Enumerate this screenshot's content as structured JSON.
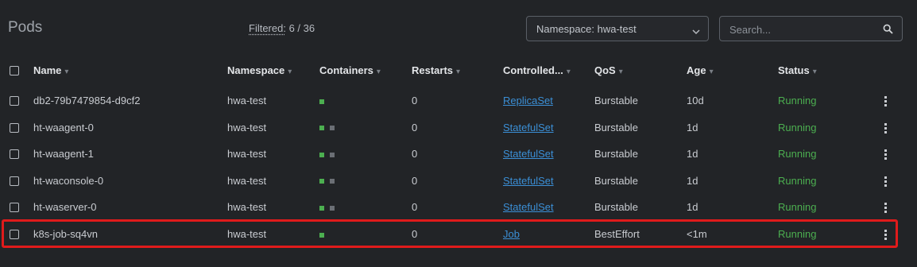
{
  "page": {
    "title": "Pods",
    "filtered_label": "Filtered:",
    "filtered_count": "6 / 36"
  },
  "namespace_select": {
    "label": "Namespace: hwa-test",
    "icon": "chevron-down-icon"
  },
  "search": {
    "placeholder": "Search...",
    "icon": "search-icon"
  },
  "table": {
    "columns": [
      "Name",
      "Namespace",
      "Containers",
      "Restarts",
      "Controlled...",
      "QoS",
      "Age",
      "Status"
    ],
    "rows": [
      {
        "name": "db2-79b7479854-d9cf2",
        "namespace": "hwa-test",
        "containers": [
          "running"
        ],
        "restarts": "0",
        "controlled_by": "ReplicaSet",
        "qos": "Burstable",
        "age": "10d",
        "status": "Running"
      },
      {
        "name": "ht-waagent-0",
        "namespace": "hwa-test",
        "containers": [
          "running",
          "terminated"
        ],
        "restarts": "0",
        "controlled_by": "StatefulSet",
        "qos": "Burstable",
        "age": "1d",
        "status": "Running"
      },
      {
        "name": "ht-waagent-1",
        "namespace": "hwa-test",
        "containers": [
          "running",
          "terminated"
        ],
        "restarts": "0",
        "controlled_by": "StatefulSet",
        "qos": "Burstable",
        "age": "1d",
        "status": "Running"
      },
      {
        "name": "ht-waconsole-0",
        "namespace": "hwa-test",
        "containers": [
          "running",
          "terminated"
        ],
        "restarts": "0",
        "controlled_by": "StatefulSet",
        "qos": "Burstable",
        "age": "1d",
        "status": "Running"
      },
      {
        "name": "ht-waserver-0",
        "namespace": "hwa-test",
        "containers": [
          "running",
          "terminated"
        ],
        "restarts": "0",
        "controlled_by": "StatefulSet",
        "qos": "Burstable",
        "age": "1d",
        "status": "Running"
      },
      {
        "name": "k8s-job-sq4vn",
        "namespace": "hwa-test",
        "containers": [
          "running"
        ],
        "restarts": "0",
        "controlled_by": "Job",
        "qos": "BestEffort",
        "age": "<1m",
        "status": "Running"
      }
    ]
  },
  "highlighted_row_index": 5,
  "colors": {
    "background": "#222427",
    "container_running": "#4caf50",
    "container_terminated": "#6b6f75",
    "link": "#3b8fd6",
    "status_running": "#4caf50",
    "highlight": "#e01b1b"
  }
}
